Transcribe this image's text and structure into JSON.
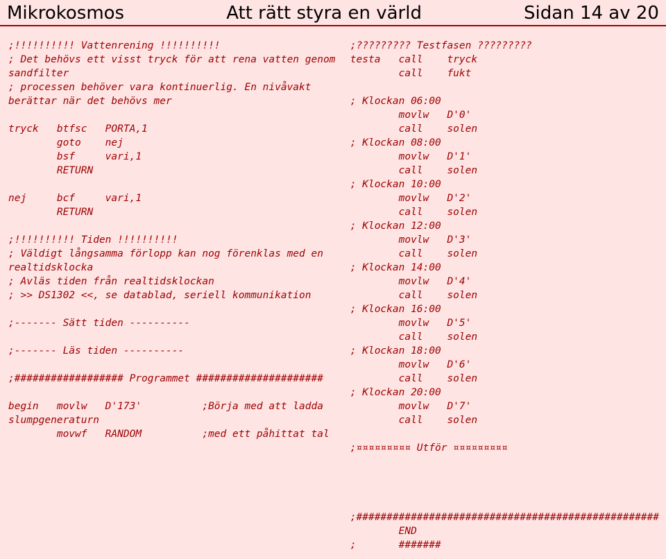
{
  "header": {
    "left": "Mikrokosmos",
    "center": "Att rätt styra en värld",
    "right": "Sidan 14 av 20"
  },
  "code_left": ";!!!!!!!!!! Vattenrening !!!!!!!!!!\n; Det behövs ett visst tryck för att rena vatten genom\nsandfilter\n; processen behöver vara kontinuerlig. En nivåvakt\nberättar när det behövs mer\n\ntryck   btfsc   PORTA,1\n        goto    nej\n        bsf     vari,1\n        RETURN\n\nnej     bcf     vari,1\n        RETURN\n\n;!!!!!!!!!! Tiden !!!!!!!!!!\n; Väldigt långsamma förlopp kan nog förenklas med en\nrealtidsklocka\n; Avläs tiden från realtidsklockan\n; >> DS1302 <<, se datablad, seriell kommunikation\n\n;------- Sätt tiden ----------\n\n;------- Läs tiden ----------\n\n;################## Programmet #####################\n\nbegin   movlw   D'173'          ;Börja med att ladda\nslumpgeneraturn\n        movwf   RANDOM          ;med ett påhittat tal",
  "code_right": ";????????? Testfasen ?????????\ntesta   call    tryck\n        call    fukt\n\n; Klockan 06:00\n        movlw   D'0'\n        call    solen\n; Klockan 08:00\n        movlw   D'1'\n        call    solen\n; Klockan 10:00\n        movlw   D'2'\n        call    solen\n; Klockan 12:00\n        movlw   D'3'\n        call    solen\n; Klockan 14:00\n        movlw   D'4'\n        call    solen\n; Klockan 16:00\n        movlw   D'5'\n        call    solen\n; Klockan 18:00\n        movlw   D'6'\n        call    solen\n; Klockan 20:00\n        movlw   D'7'\n        call    solen\n\n;¤¤¤¤¤¤¤¤¤ Utför ¤¤¤¤¤¤¤¤¤\n\n\n\n\n;##################################################\n        END\n;       #######"
}
